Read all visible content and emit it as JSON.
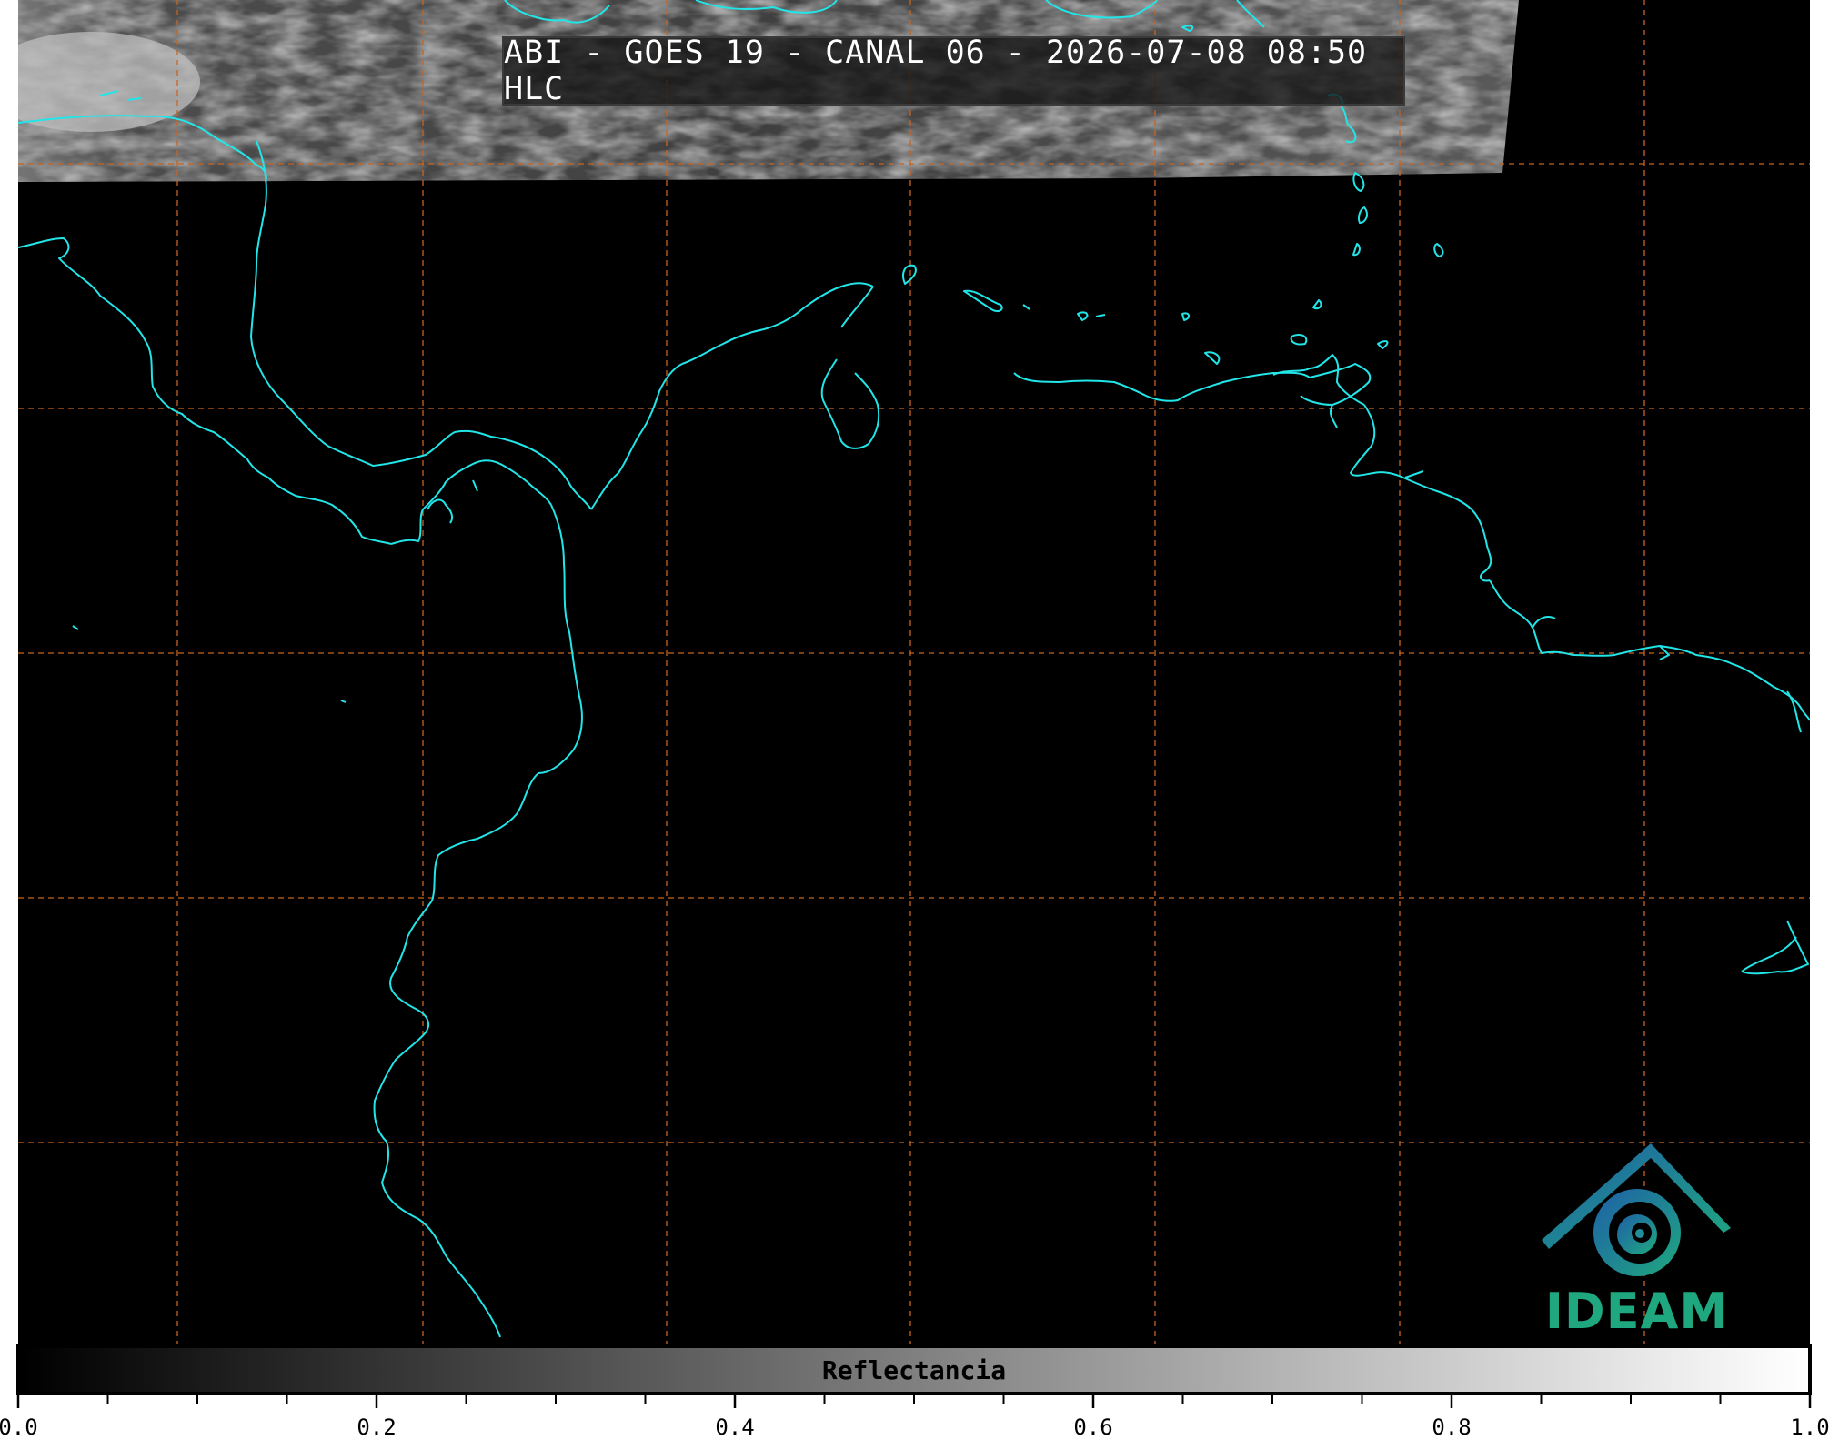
{
  "title": "ABI - GOES 19 - CANAL 06 - 2026-07-08 08:50 HLC",
  "colorbar": {
    "label": "Reflectancia",
    "range": [
      0.0,
      1.0
    ],
    "ticks": [
      "0.0",
      "0.2",
      "0.4",
      "0.6",
      "0.8",
      "1.0"
    ],
    "colormap": [
      "#000000",
      "#ffffff"
    ]
  },
  "logo": {
    "text": "IDEAM"
  },
  "colors": {
    "coastline": "#22e5e8",
    "graticule": "#c8641e",
    "background": "#000000"
  },
  "graticule": {
    "style": "dashed",
    "columns": 7,
    "rows": 6
  }
}
